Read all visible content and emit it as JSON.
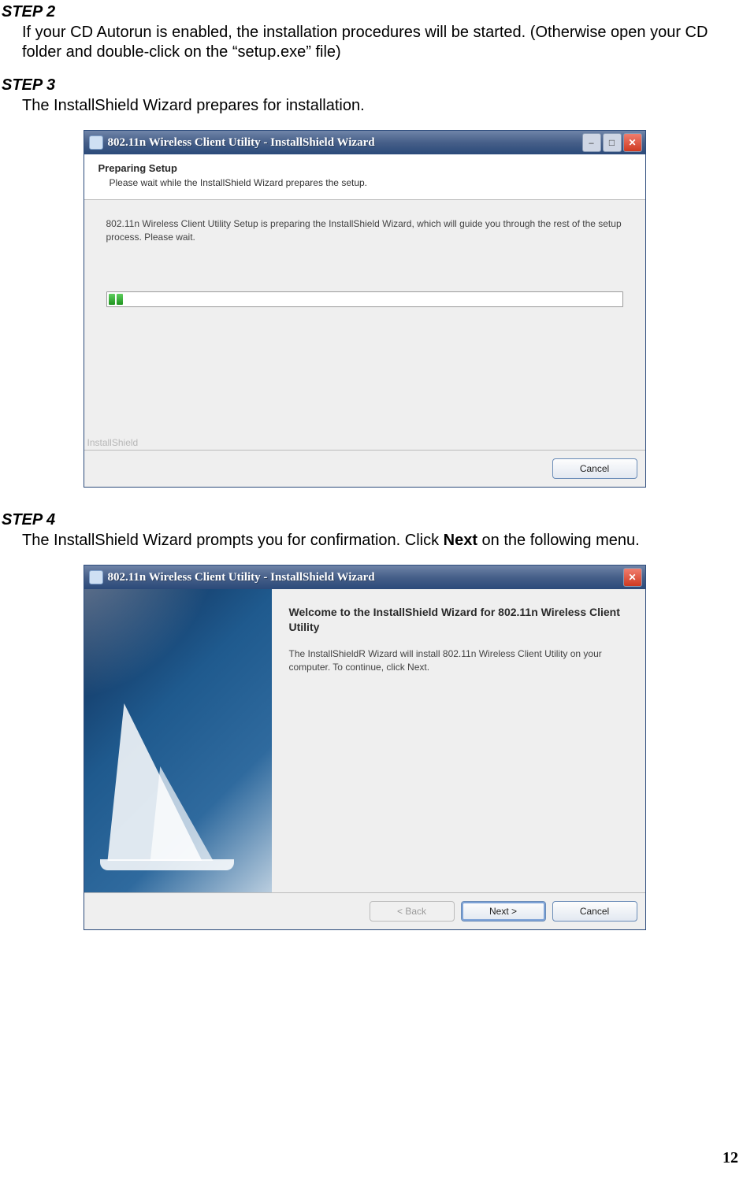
{
  "steps": {
    "s2": {
      "heading": "STEP 2",
      "body": "If your CD Autorun is enabled, the installation procedures will be started. (Otherwise open your CD folder and double-click on the “setup.exe” file)"
    },
    "s3": {
      "heading": "STEP 3",
      "body": "The InstallShield Wizard prepares for installation."
    },
    "s4": {
      "heading": "STEP 4",
      "body_prefix": "The InstallShield Wizard prompts you for confirmation. Click ",
      "body_bold": "Next",
      "body_suffix": " on the following menu."
    }
  },
  "dialog1": {
    "title": "802.11n  Wireless Client Utility - InstallShield  Wizard",
    "header_title": "Preparing Setup",
    "header_sub": "Please wait while the InstallShield Wizard prepares the setup.",
    "message": "802.11n Wireless Client Utility Setup is preparing the InstallShield Wizard, which will guide you through the rest of the setup process. Please wait.",
    "watermark": "InstallShield",
    "cancel": "Cancel",
    "minimize_glyph": "–",
    "maximize_glyph": "□",
    "close_glyph": "✕"
  },
  "dialog2": {
    "title": "802.11n  Wireless Client Utility - InstallShield  Wizard",
    "close_glyph": "✕",
    "welcome_title": "Welcome to the InstallShield Wizard for 802.11n Wireless Client Utility",
    "welcome_text": "The InstallShieldR Wizard will install 802.11n Wireless Client Utility on your computer.  To continue, click Next.",
    "back": "< Back",
    "next": "Next >",
    "cancel": "Cancel"
  },
  "page_number": "12"
}
